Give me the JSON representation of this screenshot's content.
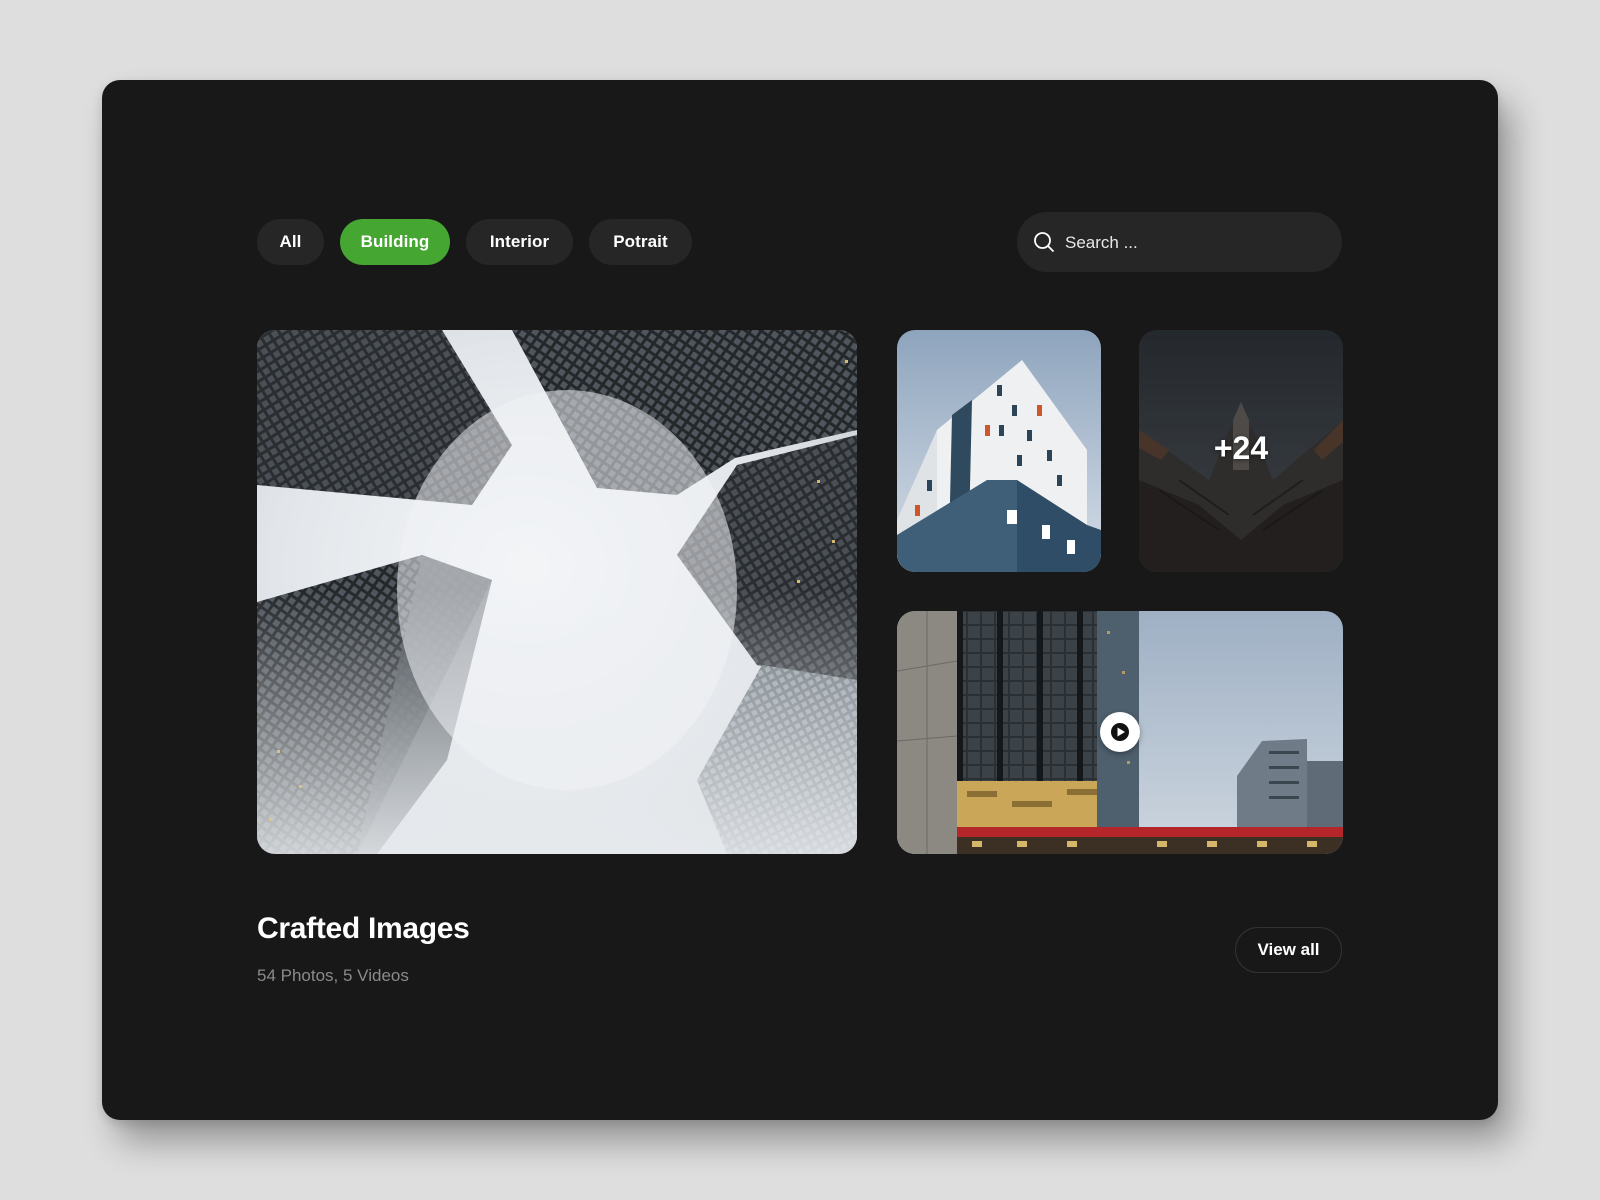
{
  "filters": {
    "items": [
      {
        "label": "All",
        "active": false
      },
      {
        "label": "Building",
        "active": true
      },
      {
        "label": "Interior",
        "active": false
      },
      {
        "label": "Potrait",
        "active": false
      }
    ]
  },
  "search": {
    "placeholder": "Search ...",
    "value": "",
    "icon": "search-icon"
  },
  "gallery": {
    "more_count": "+24",
    "video_icon": "play-icon"
  },
  "collection": {
    "title": "Crafted Images",
    "subtitle": "54 Photos, 5 Videos",
    "view_all_label": "View all"
  },
  "colors": {
    "card_background": "#181818",
    "page_background": "#dedede",
    "chip_background": "#262626",
    "accent": "#45a632",
    "subtitle_text": "#8a8a8a"
  }
}
